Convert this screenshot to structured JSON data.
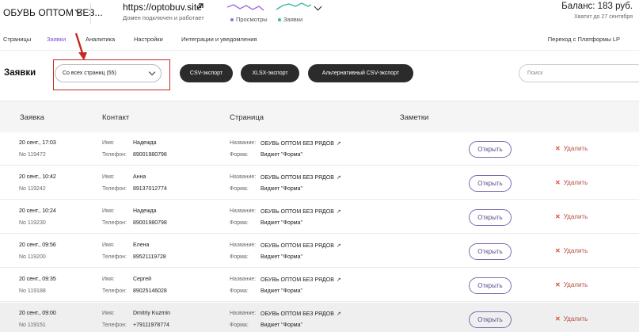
{
  "header": {
    "site_title": "ОБУВЬ ОПТОМ БЕЗ...",
    "site_url": "https://optobuv.site",
    "site_status": "Домен подключен и работает",
    "legend_views": "Просмотры",
    "legend_leads": "Заявки",
    "balance": "Баланс: 183 руб.",
    "balance_sub": "Хватит до 27 сентября",
    "colors": {
      "accent": "#7b4dd8",
      "views": "#9b6be0",
      "leads": "#3ab6a6"
    }
  },
  "nav": {
    "tabs": [
      "Страницы",
      "Заявки",
      "Аналитика",
      "Настройки",
      "Интеграции и уведомления"
    ],
    "active_index": 1,
    "right_link": "Переход с Платформы LP"
  },
  "toolbar": {
    "heading": "Заявки",
    "page_filter": "Со всех страниц (55)",
    "csv_export": "CSV-экспорт",
    "xlsx_export": "XLSX-экспорт",
    "alt_csv_export": "Альтернативный CSV-экспорт",
    "search_placeholder": "Поиск"
  },
  "table": {
    "columns": [
      "Заявка",
      "Контакт",
      "Страница",
      "Заметки"
    ],
    "labels": {
      "name": "Имя:",
      "phone": "Телефон:",
      "title": "Название:",
      "form": "Форма:",
      "open": "Открыть",
      "delete": "Удалить"
    },
    "rows": [
      {
        "date": "20 сент., 17:03",
        "num": "No 119472",
        "name": "Надежда",
        "phone": "89001980798",
        "page": "ОБУВЬ ОПТОМ БЕЗ РЯДОВ",
        "form": "Виджет \"Форма\""
      },
      {
        "date": "20 сент., 10:42",
        "num": "No 119242",
        "name": "Анна",
        "phone": "89137012774",
        "page": "ОБУВЬ ОПТОМ БЕЗ РЯДОВ",
        "form": "Виджет \"Форма\""
      },
      {
        "date": "20 сент., 10:24",
        "num": "No 119230",
        "name": "Надежда",
        "phone": "89001980798",
        "page": "ОБУВЬ ОПТОМ БЕЗ РЯДОВ",
        "form": "Виджет \"Форма\""
      },
      {
        "date": "20 сент., 09:56",
        "num": "No 119200",
        "name": "Елена",
        "phone": "89521119728",
        "page": "ОБУВЬ ОПТОМ БЕЗ РЯДОВ",
        "form": "Виджет \"Форма\""
      },
      {
        "date": "20 сент., 09:35",
        "num": "No 119188",
        "name": "Сергей",
        "phone": "89025146028",
        "page": "ОБУВЬ ОПТОМ БЕЗ РЯДОВ",
        "form": "Виджет \"Форма\""
      },
      {
        "date": "20 сент., 09:00",
        "num": "No 119151",
        "name": "Dmitriy Kuzmin",
        "phone": "+79111978774",
        "page": "ОБУВЬ ОПТОМ БЕЗ РЯДОВ",
        "form": "Виджет \"Форма\""
      }
    ]
  }
}
